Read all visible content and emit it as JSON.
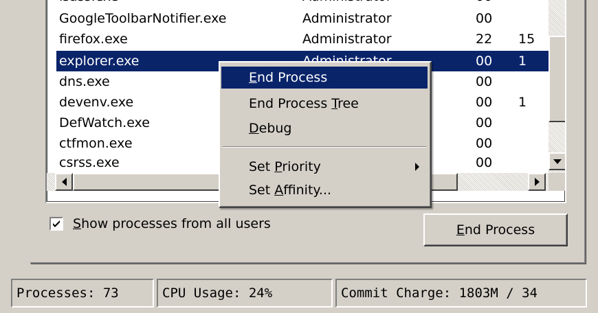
{
  "processes": [
    {
      "name": "GoogleToolbarNotifier.exe",
      "user": "Administrator",
      "cpu": "00",
      "mem": ""
    },
    {
      "name": "firefox.exe",
      "user": "Administrator",
      "cpu": "22",
      "mem": "15"
    },
    {
      "name": "explorer.exe",
      "user": "Administrator",
      "cpu": "00",
      "mem": "1"
    },
    {
      "name": "dns.exe",
      "user": "",
      "cpu": "00",
      "mem": ""
    },
    {
      "name": "devenv.exe",
      "user": "",
      "cpu": "00",
      "mem": "1"
    },
    {
      "name": "DefWatch.exe",
      "user": "",
      "cpu": "00",
      "mem": ""
    },
    {
      "name": "ctfmon.exe",
      "user": "",
      "cpu": "00",
      "mem": ""
    },
    {
      "name": "csrss.exe",
      "user": "",
      "cpu": "00",
      "mem": ""
    }
  ],
  "context_menu": {
    "end_process": {
      "pre": "",
      "key": "E",
      "post": "nd Process"
    },
    "end_process_tree": {
      "pre": "End Process ",
      "key": "T",
      "post": "ree"
    },
    "debug": {
      "pre": "",
      "key": "D",
      "post": "ebug"
    },
    "set_priority": {
      "pre": "Set ",
      "key": "P",
      "post": "riority"
    },
    "set_affinity": {
      "pre": "Set ",
      "key": "A",
      "post": "ffinity..."
    }
  },
  "show_all_users": {
    "checked": true,
    "key": "S",
    "rest": "how processes from all users"
  },
  "end_process_button": {
    "key": "E",
    "rest": "nd Process"
  },
  "status": {
    "processes": "Processes: 73",
    "cpu": "CPU Usage: 24%",
    "commit": "Commit Charge: 1803M / 34"
  },
  "colors": {
    "selection": "#0a246a",
    "face": "#d4d0c8"
  }
}
